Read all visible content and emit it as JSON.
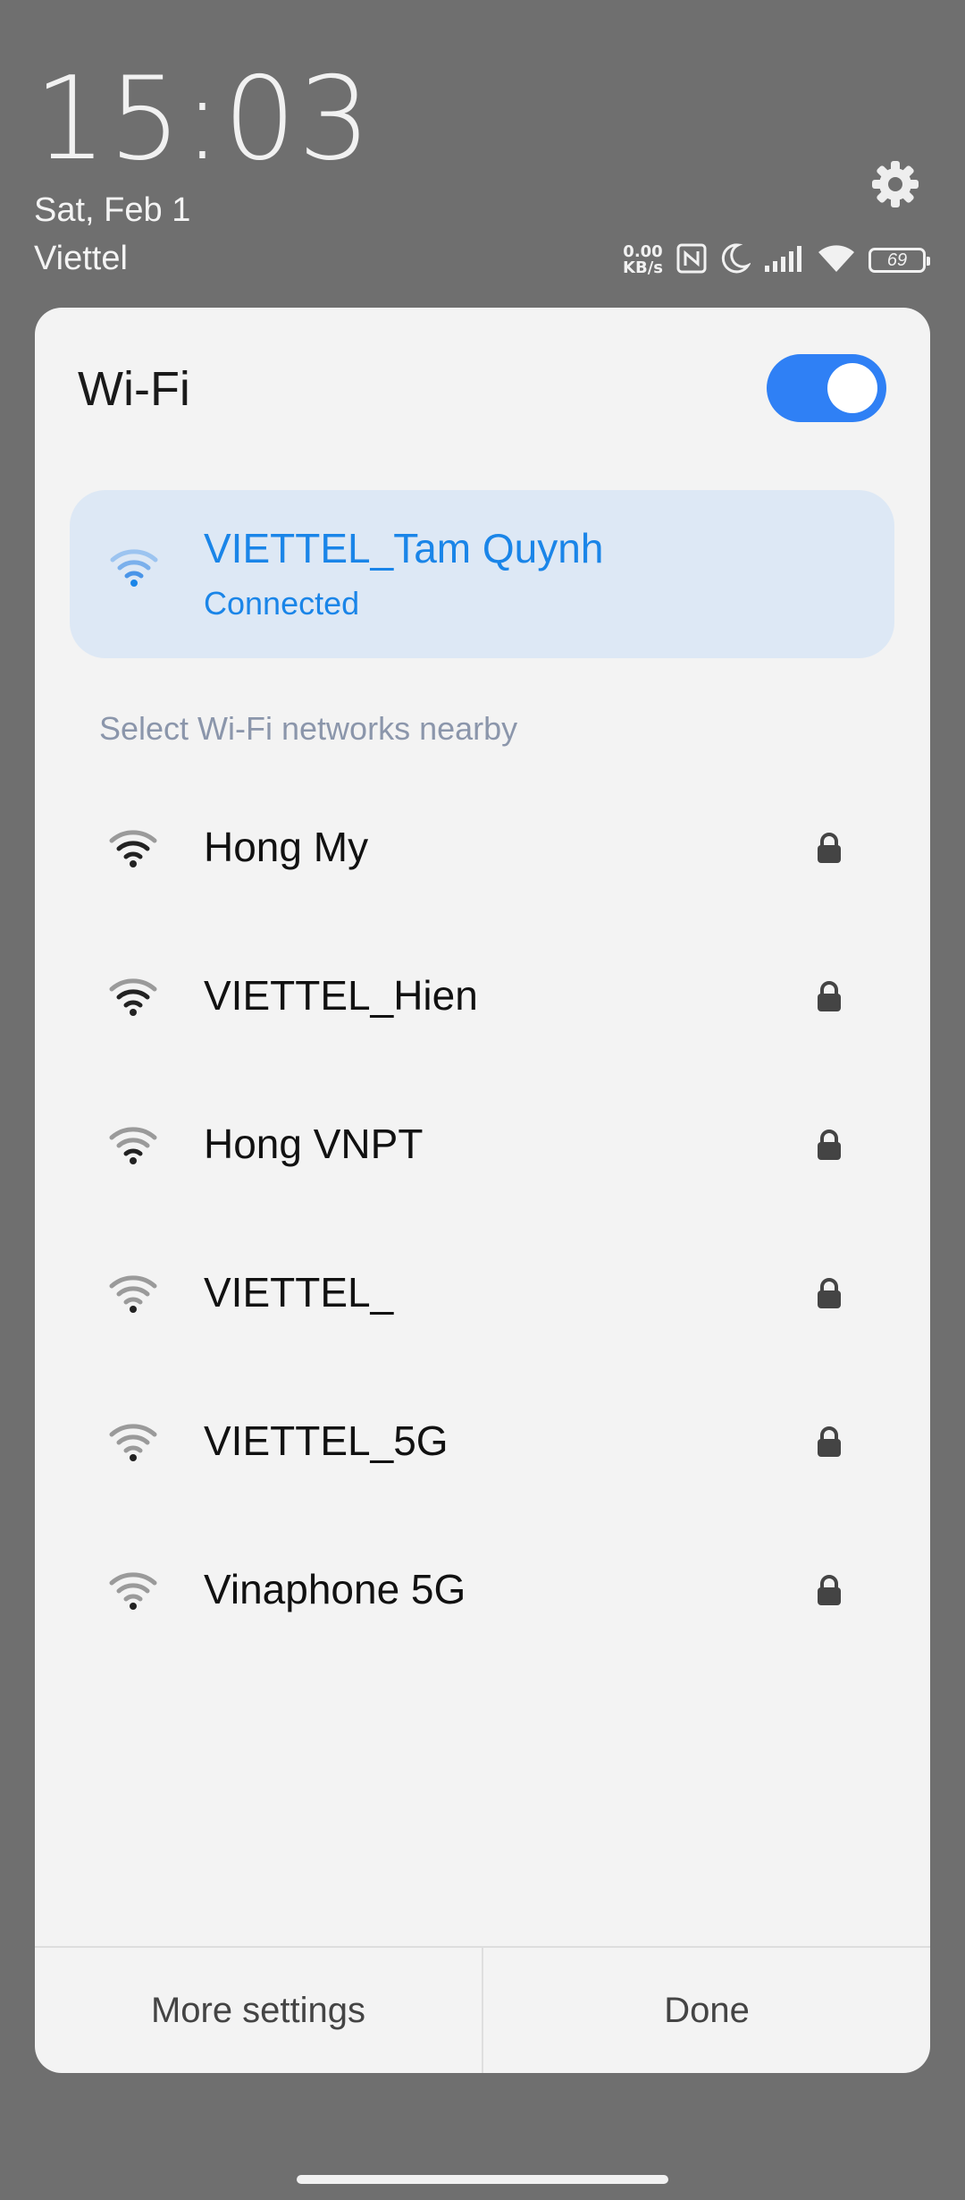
{
  "status_bar": {
    "time": "15:03",
    "date": "Sat, Feb 1",
    "carrier": "Viettel",
    "net_speed_value": "0.00",
    "net_speed_unit": "KB/s",
    "battery_level": "69",
    "icons": [
      "nfc-icon",
      "moon-icon",
      "signal-icon",
      "wifi-icon",
      "battery-icon"
    ]
  },
  "wifi_panel": {
    "title": "Wi-Fi",
    "enabled": true,
    "accent_color": "#2f80f5",
    "connected": {
      "name": "VIETTEL_Tam Quynh",
      "status": "Connected"
    },
    "section_label": "Select Wi-Fi networks nearby",
    "networks": [
      {
        "name": "Hong My",
        "secured": true,
        "signal": "strong"
      },
      {
        "name": "VIETTEL_Hien",
        "secured": true,
        "signal": "strong"
      },
      {
        "name": "Hong VNPT",
        "secured": true,
        "signal": "medium"
      },
      {
        "name": "VIETTEL_",
        "secured": true,
        "signal": "weak"
      },
      {
        "name": "VIETTEL_5G",
        "secured": true,
        "signal": "weak"
      },
      {
        "name": "Vinaphone 5G",
        "secured": true,
        "signal": "weak"
      }
    ],
    "buttons": {
      "more_settings": "More settings",
      "done": "Done"
    }
  }
}
